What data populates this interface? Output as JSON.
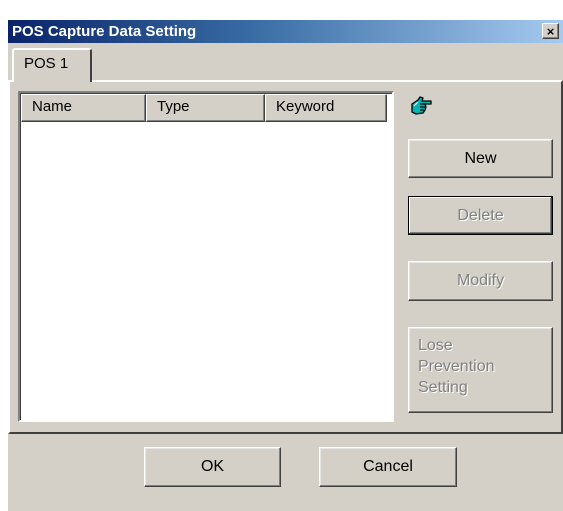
{
  "window": {
    "title": "POS Capture Data Setting",
    "close_glyph": "×"
  },
  "tabs": [
    {
      "label": "POS 1",
      "selected": true
    }
  ],
  "list": {
    "columns": [
      "Name",
      "Type",
      "Keyword"
    ],
    "rows": []
  },
  "icons": {
    "hand": "pointing-hand-icon"
  },
  "buttons": {
    "new": "New",
    "delete": "Delete",
    "modify": "Modify",
    "lose_prevention": [
      "Lose",
      "Prevention",
      "Setting"
    ],
    "ok": "OK",
    "cancel": "Cancel"
  },
  "colors": {
    "face": "#d4d0c8",
    "title_start": "#0a246a",
    "title_end": "#a6caf0",
    "disabled_text": "#808080"
  }
}
